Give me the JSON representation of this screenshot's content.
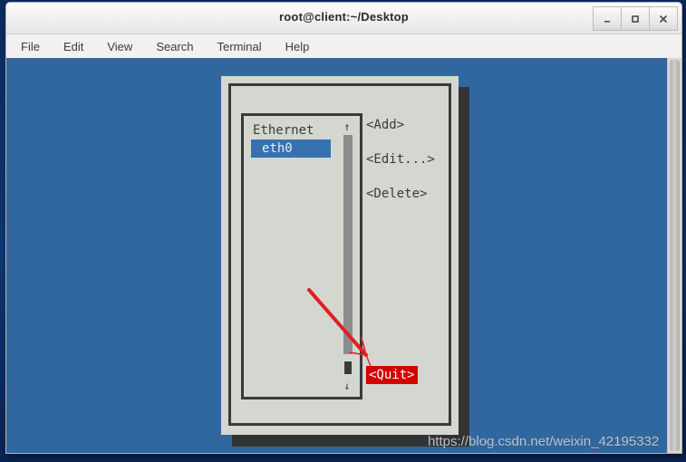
{
  "window": {
    "title": "root@client:~/Desktop",
    "buttons": [
      {
        "name": "minimize",
        "glyph": "_"
      },
      {
        "name": "maximize",
        "glyph": "□"
      },
      {
        "name": "close",
        "glyph": "×"
      }
    ]
  },
  "menubar": {
    "items": [
      "File",
      "Edit",
      "View",
      "Search",
      "Terminal",
      "Help"
    ]
  },
  "dialog": {
    "list": {
      "group_label": "Ethernet",
      "selected_item": "eth0",
      "scroll_up_glyph": "↑",
      "scroll_down_glyph": "↓"
    },
    "actions": [
      "<Add>",
      "<Edit...>",
      "<Delete>"
    ],
    "quit_label": "<Quit>"
  },
  "annotation": {
    "color": "#e02020",
    "target": "<Quit>"
  },
  "watermark": {
    "text": "https://blog.csdn.net/weixin_42195332"
  },
  "colors": {
    "desktop": "#0d2f66",
    "terminal_bg": "#31679f",
    "dialog_bg": "#d4d7d0",
    "dialog_border": "#3a3a3a",
    "selection_blue": "#3572b0",
    "highlight_red": "#d40000"
  }
}
